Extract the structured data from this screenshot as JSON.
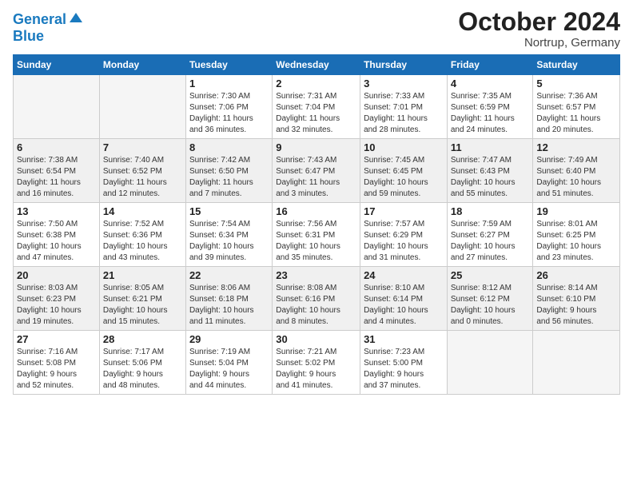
{
  "header": {
    "logo_line1": "General",
    "logo_line2": "Blue",
    "month": "October 2024",
    "location": "Nortrup, Germany"
  },
  "weekdays": [
    "Sunday",
    "Monday",
    "Tuesday",
    "Wednesday",
    "Thursday",
    "Friday",
    "Saturday"
  ],
  "weeks": [
    [
      {
        "day": "",
        "info": ""
      },
      {
        "day": "",
        "info": ""
      },
      {
        "day": "1",
        "info": "Sunrise: 7:30 AM\nSunset: 7:06 PM\nDaylight: 11 hours\nand 36 minutes."
      },
      {
        "day": "2",
        "info": "Sunrise: 7:31 AM\nSunset: 7:04 PM\nDaylight: 11 hours\nand 32 minutes."
      },
      {
        "day": "3",
        "info": "Sunrise: 7:33 AM\nSunset: 7:01 PM\nDaylight: 11 hours\nand 28 minutes."
      },
      {
        "day": "4",
        "info": "Sunrise: 7:35 AM\nSunset: 6:59 PM\nDaylight: 11 hours\nand 24 minutes."
      },
      {
        "day": "5",
        "info": "Sunrise: 7:36 AM\nSunset: 6:57 PM\nDaylight: 11 hours\nand 20 minutes."
      }
    ],
    [
      {
        "day": "6",
        "info": "Sunrise: 7:38 AM\nSunset: 6:54 PM\nDaylight: 11 hours\nand 16 minutes."
      },
      {
        "day": "7",
        "info": "Sunrise: 7:40 AM\nSunset: 6:52 PM\nDaylight: 11 hours\nand 12 minutes."
      },
      {
        "day": "8",
        "info": "Sunrise: 7:42 AM\nSunset: 6:50 PM\nDaylight: 11 hours\nand 7 minutes."
      },
      {
        "day": "9",
        "info": "Sunrise: 7:43 AM\nSunset: 6:47 PM\nDaylight: 11 hours\nand 3 minutes."
      },
      {
        "day": "10",
        "info": "Sunrise: 7:45 AM\nSunset: 6:45 PM\nDaylight: 10 hours\nand 59 minutes."
      },
      {
        "day": "11",
        "info": "Sunrise: 7:47 AM\nSunset: 6:43 PM\nDaylight: 10 hours\nand 55 minutes."
      },
      {
        "day": "12",
        "info": "Sunrise: 7:49 AM\nSunset: 6:40 PM\nDaylight: 10 hours\nand 51 minutes."
      }
    ],
    [
      {
        "day": "13",
        "info": "Sunrise: 7:50 AM\nSunset: 6:38 PM\nDaylight: 10 hours\nand 47 minutes."
      },
      {
        "day": "14",
        "info": "Sunrise: 7:52 AM\nSunset: 6:36 PM\nDaylight: 10 hours\nand 43 minutes."
      },
      {
        "day": "15",
        "info": "Sunrise: 7:54 AM\nSunset: 6:34 PM\nDaylight: 10 hours\nand 39 minutes."
      },
      {
        "day": "16",
        "info": "Sunrise: 7:56 AM\nSunset: 6:31 PM\nDaylight: 10 hours\nand 35 minutes."
      },
      {
        "day": "17",
        "info": "Sunrise: 7:57 AM\nSunset: 6:29 PM\nDaylight: 10 hours\nand 31 minutes."
      },
      {
        "day": "18",
        "info": "Sunrise: 7:59 AM\nSunset: 6:27 PM\nDaylight: 10 hours\nand 27 minutes."
      },
      {
        "day": "19",
        "info": "Sunrise: 8:01 AM\nSunset: 6:25 PM\nDaylight: 10 hours\nand 23 minutes."
      }
    ],
    [
      {
        "day": "20",
        "info": "Sunrise: 8:03 AM\nSunset: 6:23 PM\nDaylight: 10 hours\nand 19 minutes."
      },
      {
        "day": "21",
        "info": "Sunrise: 8:05 AM\nSunset: 6:21 PM\nDaylight: 10 hours\nand 15 minutes."
      },
      {
        "day": "22",
        "info": "Sunrise: 8:06 AM\nSunset: 6:18 PM\nDaylight: 10 hours\nand 11 minutes."
      },
      {
        "day": "23",
        "info": "Sunrise: 8:08 AM\nSunset: 6:16 PM\nDaylight: 10 hours\nand 8 minutes."
      },
      {
        "day": "24",
        "info": "Sunrise: 8:10 AM\nSunset: 6:14 PM\nDaylight: 10 hours\nand 4 minutes."
      },
      {
        "day": "25",
        "info": "Sunrise: 8:12 AM\nSunset: 6:12 PM\nDaylight: 10 hours\nand 0 minutes."
      },
      {
        "day": "26",
        "info": "Sunrise: 8:14 AM\nSunset: 6:10 PM\nDaylight: 9 hours\nand 56 minutes."
      }
    ],
    [
      {
        "day": "27",
        "info": "Sunrise: 7:16 AM\nSunset: 5:08 PM\nDaylight: 9 hours\nand 52 minutes."
      },
      {
        "day": "28",
        "info": "Sunrise: 7:17 AM\nSunset: 5:06 PM\nDaylight: 9 hours\nand 48 minutes."
      },
      {
        "day": "29",
        "info": "Sunrise: 7:19 AM\nSunset: 5:04 PM\nDaylight: 9 hours\nand 44 minutes."
      },
      {
        "day": "30",
        "info": "Sunrise: 7:21 AM\nSunset: 5:02 PM\nDaylight: 9 hours\nand 41 minutes."
      },
      {
        "day": "31",
        "info": "Sunrise: 7:23 AM\nSunset: 5:00 PM\nDaylight: 9 hours\nand 37 minutes."
      },
      {
        "day": "",
        "info": ""
      },
      {
        "day": "",
        "info": ""
      }
    ]
  ]
}
